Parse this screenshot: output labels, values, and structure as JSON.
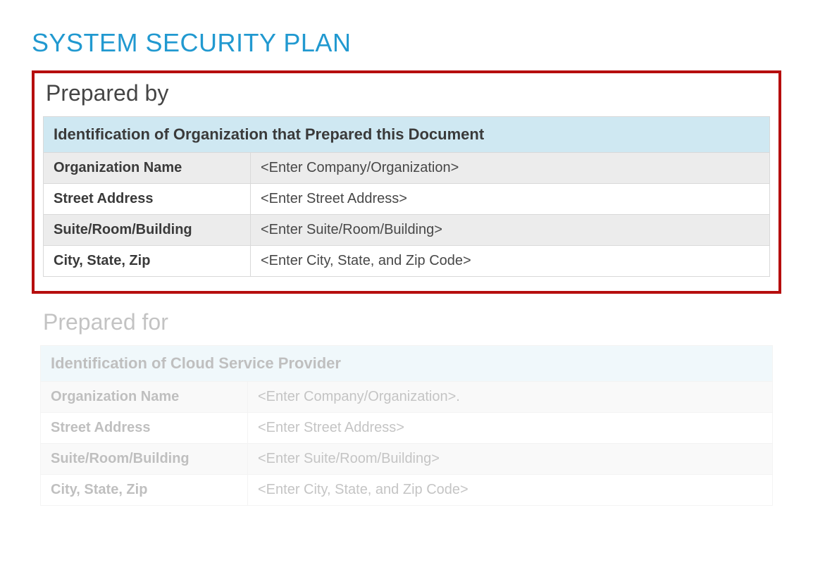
{
  "title": "SYSTEM SECURITY PLAN",
  "prepared_by": {
    "heading": "Prepared by",
    "table_header": "Identification of Organization that Prepared this Document",
    "rows": [
      {
        "label": "Organization Name",
        "value": "<Enter Company/Organization>"
      },
      {
        "label": "Street Address",
        "value": "<Enter Street Address>"
      },
      {
        "label": "Suite/Room/Building",
        "value": "<Enter Suite/Room/Building>"
      },
      {
        "label": "City, State, Zip",
        "value": "<Enter City, State, and Zip Code>"
      }
    ]
  },
  "prepared_for": {
    "heading": "Prepared for",
    "table_header": "Identification of Cloud Service Provider",
    "rows": [
      {
        "label": "Organization Name",
        "value": "<Enter Company/Organization>."
      },
      {
        "label": "Street Address",
        "value": "<Enter Street Address>"
      },
      {
        "label": "Suite/Room/Building",
        "value": "<Enter Suite/Room/Building>"
      },
      {
        "label": "City, State, Zip",
        "value": "<Enter City, State, and Zip Code>"
      }
    ]
  }
}
